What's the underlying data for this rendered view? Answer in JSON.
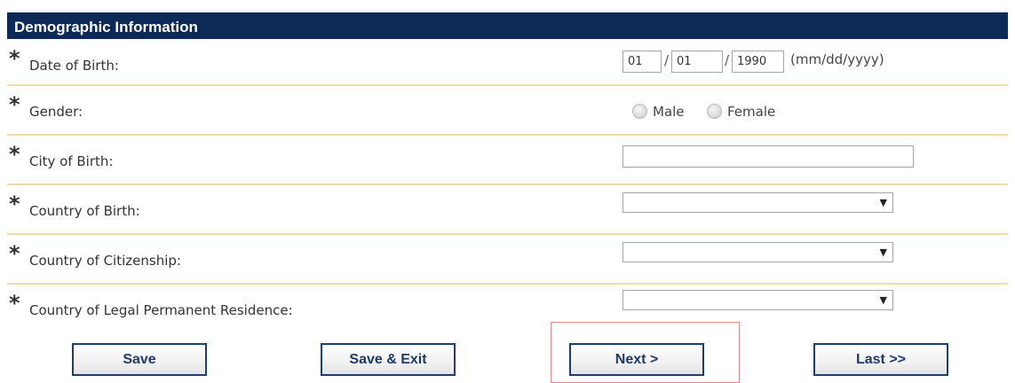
{
  "header": {
    "title": "Demographic Information"
  },
  "required_marker": "*",
  "dob": {
    "label": "Date of Birth:",
    "month": "01",
    "day": "01",
    "year": "1990",
    "separator": "/",
    "format_hint": "(mm/dd/yyyy)"
  },
  "gender": {
    "label": "Gender:",
    "options": [
      "Male",
      "Female"
    ]
  },
  "city_of_birth": {
    "label": "City of Birth:",
    "value": ""
  },
  "country_of_birth": {
    "label": "Country of Birth:",
    "value": ""
  },
  "country_of_citizenship": {
    "label": "Country of Citizenship:",
    "value": ""
  },
  "country_of_residence": {
    "label": "Country of Legal Permanent Residence:",
    "value": ""
  },
  "buttons": {
    "save": "Save",
    "save_exit": "Save & Exit",
    "next": "Next >",
    "last": "Last >>"
  },
  "icons": {
    "dropdown": "▼"
  },
  "colors": {
    "header_bg": "#0d2a57",
    "row_divider": "#e9dcb3",
    "button_border": "#1e3f6e",
    "highlight_border": "#e6878c"
  }
}
